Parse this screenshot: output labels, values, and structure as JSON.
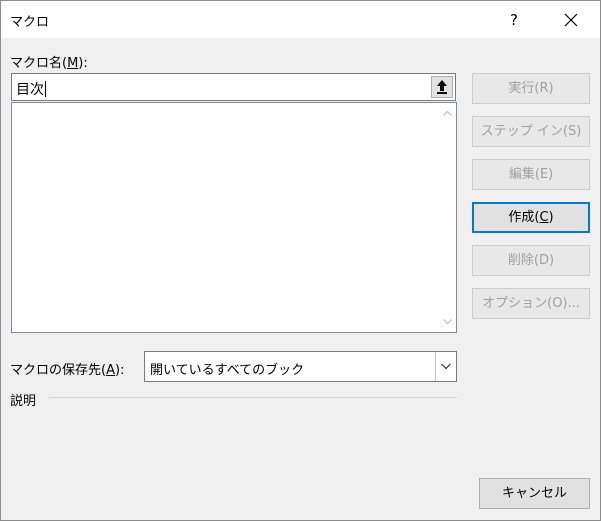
{
  "window": {
    "title": "マクロ",
    "help_label": "?"
  },
  "macro_name": {
    "label_prefix": "マクロ名(",
    "label_accel": "M",
    "label_suffix": "):",
    "value": "目次"
  },
  "macro_list": {
    "items": []
  },
  "buttons": {
    "run": {
      "prefix": "実行(",
      "accel": "R",
      "suffix": ")"
    },
    "step_into": {
      "prefix": "ステップ イン(",
      "accel": "S",
      "suffix": ")"
    },
    "edit": {
      "prefix": "編集(",
      "accel": "E",
      "suffix": ")"
    },
    "create": {
      "prefix": "作成(",
      "accel": "C",
      "suffix": ")"
    },
    "delete": {
      "prefix": "削除(",
      "accel": "D",
      "suffix": ")"
    },
    "options": {
      "prefix": "オプション(",
      "accel": "O",
      "suffix": ")..."
    },
    "cancel": "キャンセル"
  },
  "macros_in": {
    "label_prefix": "マクロの保存先(",
    "label_accel": "A",
    "label_suffix": "):",
    "selected": "開いているすべてのブック"
  },
  "description": {
    "label": "説明",
    "text": ""
  },
  "colors": {
    "accent": "#0078d7",
    "disabled_text": "#a0a0a0"
  },
  "icons": {
    "close": "close-icon",
    "collapse": "collapse-dialog-icon",
    "dropdown": "chevron-down-icon"
  }
}
